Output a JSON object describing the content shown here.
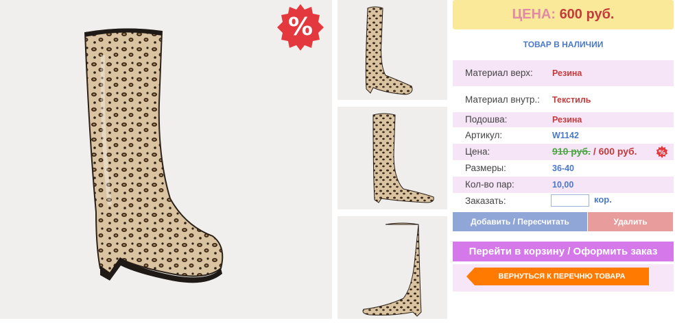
{
  "badge": {
    "symbol": "%"
  },
  "price": {
    "label": "ЦЕНА:",
    "value": "600 руб."
  },
  "stock": "ТОВАР В НАЛИЧИИ",
  "specs": [
    {
      "label": "Материал верх:",
      "value": "Резина"
    },
    {
      "label": "Материал внутр.:",
      "value": "Текстиль"
    },
    {
      "label": "Подошва:",
      "value": "Резина"
    },
    {
      "label": "Артикул:",
      "value": "W1142"
    },
    {
      "label": "Цена:",
      "old_price": "910 руб.",
      "separator": " / ",
      "new_price": "600 руб."
    },
    {
      "label": "Размеры:",
      "value": "36-40"
    },
    {
      "label": "Кол-во пар:",
      "value": "10,00"
    },
    {
      "label": "Заказать:",
      "input_value": "",
      "unit": "кор."
    }
  ],
  "buttons": {
    "add": "Добавить / Пересчитать",
    "delete": "Удалить",
    "cart": "Перейти в корзину / Оформить заказ",
    "back": "ВЕРНУТЬСЯ К ПЕРЕЧНЮ ТОВАРА"
  },
  "colors": {
    "price_box_bg": "#fbe99a",
    "accent_red": "#c43b3b",
    "accent_blue": "#4a79c7",
    "cart_button": "#d478ea",
    "back_button": "#ff7a00",
    "add_button": "#8fa6d6",
    "delete_button": "#e89c9c"
  }
}
